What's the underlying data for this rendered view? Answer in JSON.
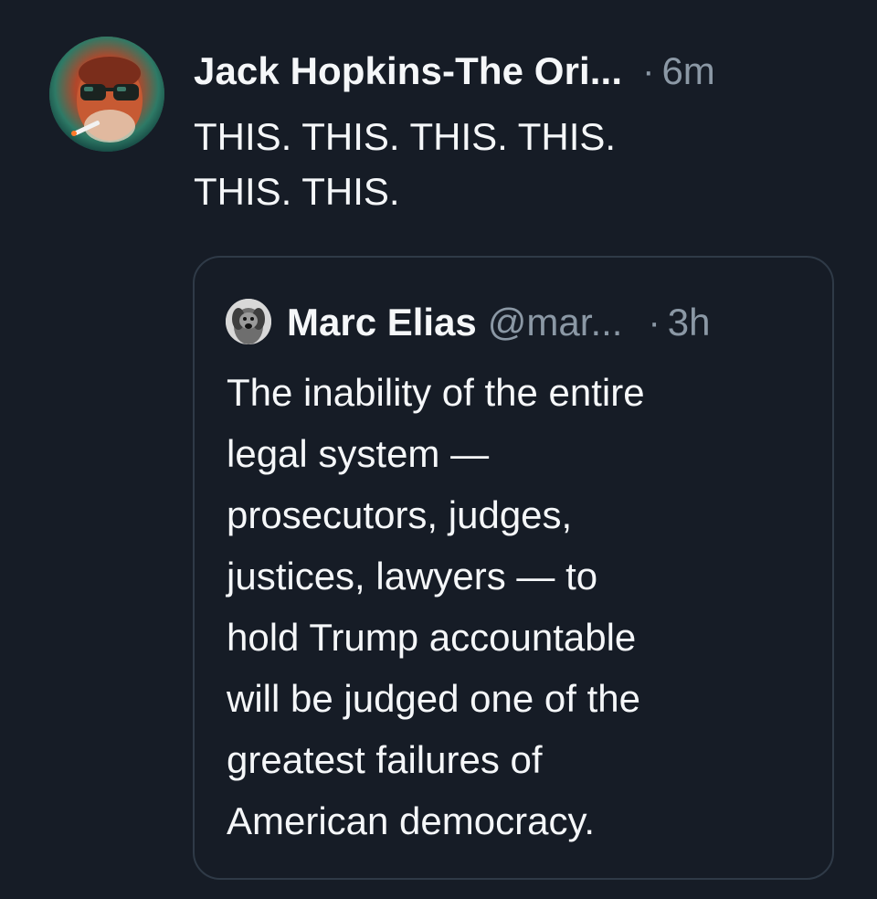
{
  "tweet": {
    "author_name": "Jack Hopkins-The Ori...",
    "separator": "·",
    "timestamp": "6m",
    "text_lines": [
      "THIS. THIS. THIS. THIS.",
      "THIS. THIS."
    ],
    "avatar_icon": "profile-photo-sunglasses-man"
  },
  "quoted_tweet": {
    "author_name": "Marc Elias",
    "handle": "@mar...",
    "separator": "·",
    "timestamp": "3h",
    "avatar_icon": "profile-photo-dog",
    "text_lines": [
      "The inability of the entire",
      "legal system —",
      "prosecutors, judges,",
      "justices, lawyers — to",
      "hold Trump accountable",
      "will be judged one of the",
      "greatest failures of",
      "American democracy."
    ]
  },
  "colors": {
    "background": "#161c26",
    "text_primary": "#f5f7f9",
    "text_secondary": "#8b98a5",
    "card_border": "#2f3a47"
  }
}
